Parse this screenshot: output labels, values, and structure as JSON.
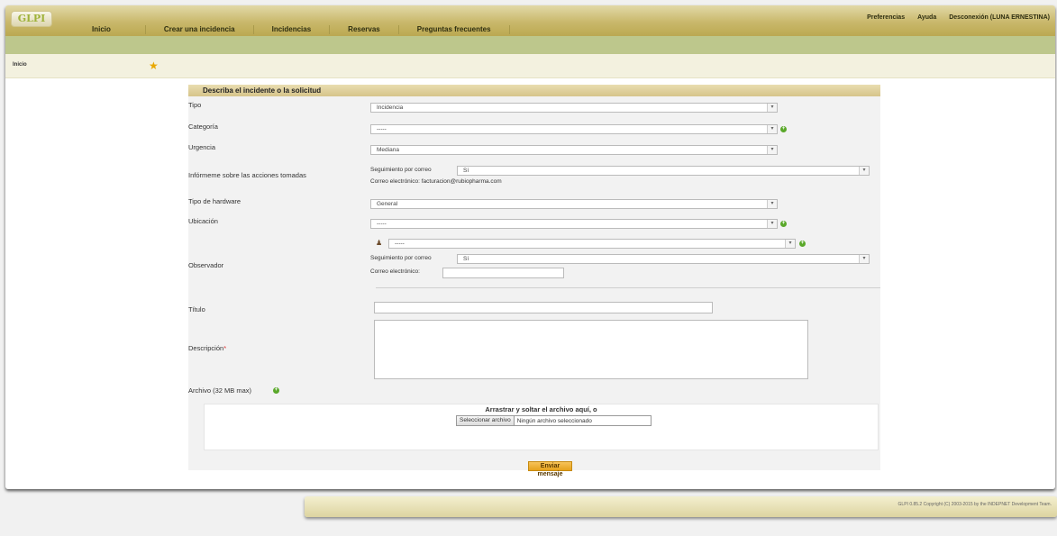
{
  "app": {
    "logo_text": "GLPI"
  },
  "nav": {
    "items": [
      "Inicio",
      "Crear una incidencia",
      "Incidencias",
      "Reservas",
      "Preguntas frecuentes"
    ]
  },
  "top_links": {
    "preferences": "Preferencias",
    "help": "Ayuda",
    "logout": "Desconexión (LUNA ERNESTINA)"
  },
  "breadcrumb": {
    "home": "Inicio"
  },
  "form": {
    "title": "Describa el incidente o la solicitud",
    "tipo": {
      "label": "Tipo",
      "value": "Incidencia"
    },
    "categoria": {
      "label": "Categoría",
      "value": "-----"
    },
    "urgencia": {
      "label": "Urgencia",
      "value": "Mediana"
    },
    "informeme": {
      "label": "Infórmeme sobre las acciones tomadas",
      "followup_label": "Seguimiento por correo",
      "followup_value": "Sí",
      "email_text": "Correo electrónico: facturacion@rubiopharma.com"
    },
    "hardware": {
      "label": "Tipo de hardware",
      "value": "General"
    },
    "ubicacion": {
      "label": "Ubicación",
      "value": "-----"
    },
    "observador": {
      "label": "Observador",
      "value": "-----",
      "followup_label": "Seguimiento por correo",
      "followup_value": "Sí",
      "email_label": "Correo electrónico:",
      "email_value": ""
    },
    "titulo": {
      "label": "Título",
      "value": ""
    },
    "descripcion": {
      "label": "Descripción",
      "required_mark": "*",
      "value": ""
    },
    "archivo": {
      "label": "Archivo (32 MB max)",
      "drop_text": "Arrastrar y soltar el archivo aquí, o",
      "button": "Seleccionar archivo",
      "status": "Ningún archivo seleccionado"
    },
    "submit": "Enviar mensaje"
  },
  "footer": {
    "text": "GLPI 0.85.2 Copyright (C) 2003-2015 by the INDEPNET Development Team."
  },
  "colors": {
    "accent": "#c9b86b",
    "subbar": "#bdc78c",
    "plus": "#5aa82a",
    "submit": "#e6a21c"
  }
}
